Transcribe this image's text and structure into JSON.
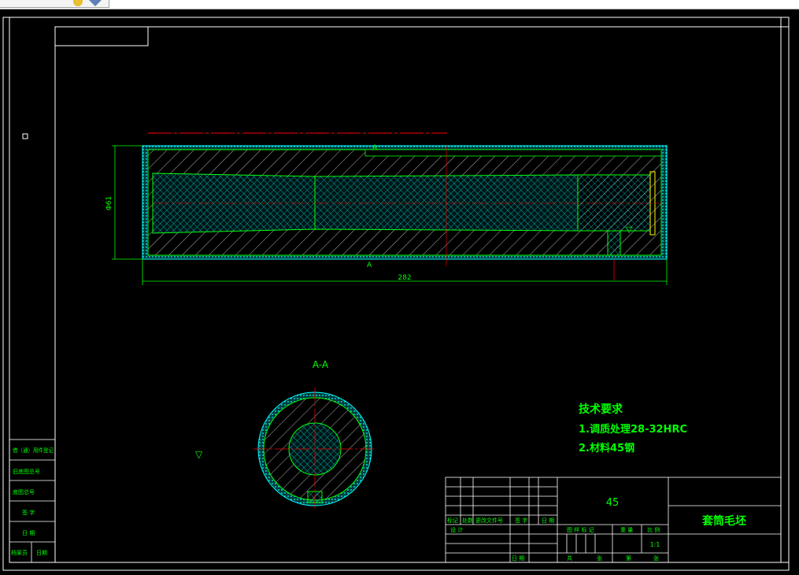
{
  "toolbar": {
    "icons": [
      "layer-icon",
      "view-cube-icon"
    ]
  },
  "drawing": {
    "section_label": "A-A",
    "dim_diameter": "Φ61",
    "dim_length": "282",
    "tech_requirements": {
      "title": "技术要求",
      "items": [
        "1.调质处理28-32HRC",
        "2.材料45钢"
      ]
    },
    "title_block": {
      "material": "45",
      "part_name": "套筒毛坯",
      "scale": "1:1",
      "row_labels": [
        "标记",
        "处数",
        "更改文件号",
        "签 字",
        "日 期"
      ],
      "designer_label": "设 计",
      "date_label": "日 期",
      "stage_label": "图 样 标 记",
      "weight_label": "重 量",
      "scale_label": "比 例",
      "sheet_total": "共",
      "sheet_unit": "张",
      "sheet_no": "第",
      "sheet_unit2": "张"
    },
    "side_block": {
      "labels": [
        "借（通）用件登记",
        "旧底图总号",
        "底图总号",
        "签 字",
        "日 期",
        "档案员",
        "日期"
      ]
    }
  },
  "colors": {
    "border": "#ffffff",
    "part_outline": "#00ff00",
    "hatch": "#00ffff",
    "centerline": "#ff0000",
    "text_green": "#00ff00"
  }
}
